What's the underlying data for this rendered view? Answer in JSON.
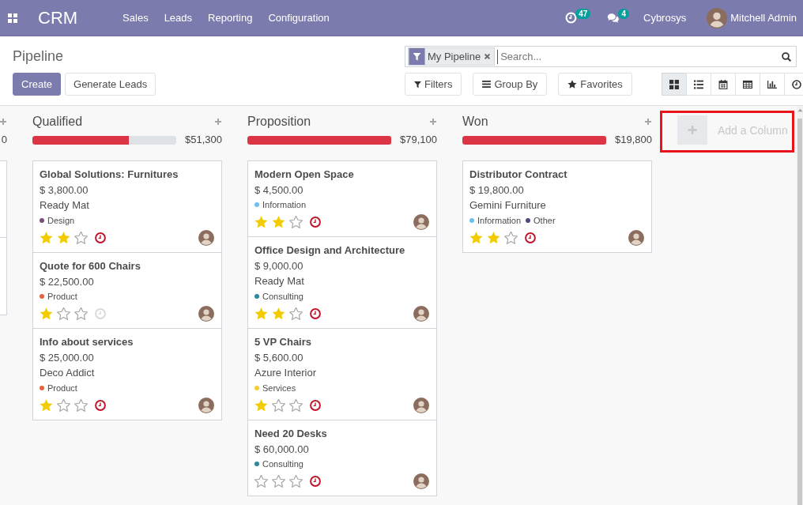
{
  "navbar": {
    "app_name": "CRM",
    "menu": [
      "Sales",
      "Leads",
      "Reporting",
      "Configuration"
    ],
    "activity_count": "47",
    "message_count": "4",
    "company": "Cybrosys",
    "user": "Mitchell Admin"
  },
  "control_panel": {
    "title": "Pipeline",
    "buttons": [
      {
        "label": "Create",
        "kind": "primary"
      },
      {
        "label": "Generate Leads",
        "kind": "secondary"
      }
    ],
    "search": {
      "facets": [
        {
          "label": "My Pipeline",
          "kind": "filter"
        }
      ],
      "placeholder": "Search..."
    },
    "search_options": [
      {
        "label": "Filters",
        "kind": "filter"
      },
      {
        "label": "Group By",
        "kind": "group"
      },
      {
        "label": "Favorites",
        "kind": "favorite"
      }
    ],
    "views": [
      {
        "kind": "kanban",
        "selected": true
      },
      {
        "kind": "list",
        "selected": false
      },
      {
        "kind": "calendar",
        "selected": false
      },
      {
        "kind": "pivot",
        "selected": false
      },
      {
        "kind": "graph",
        "selected": false
      },
      {
        "kind": "activity",
        "selected": false
      }
    ]
  },
  "kanban": {
    "partial_column": {
      "total": "0"
    },
    "columns": [
      {
        "title": "Qualified",
        "level": 0.67,
        "total": "$51,300",
        "cards": [
          {
            "title": "Global Solutions: Furnitures",
            "amount": "$ 3,800.00",
            "company": "Ready Mat",
            "tags": [
              {
                "label": "Design",
                "color": "#7c4e7a"
              }
            ],
            "stars": 2,
            "activity_overdue": true
          },
          {
            "title": "Quote for 600 Chairs",
            "amount": "$ 22,500.00",
            "tags": [
              {
                "label": "Product",
                "color": "#e4643f"
              }
            ],
            "stars": 1,
            "activity_overdue": false
          },
          {
            "title": "Info about services",
            "amount": "$ 25,000.00",
            "company": "Deco Addict",
            "tags": [
              {
                "label": "Product",
                "color": "#e4643f"
              }
            ],
            "stars": 1,
            "activity_overdue": true
          }
        ]
      },
      {
        "title": "Proposition",
        "level": 1,
        "total": "$79,100",
        "cards": [
          {
            "title": "Modern Open Space",
            "amount": "$ 4,500.00",
            "tags": [
              {
                "label": "Information",
                "color": "#6cbfee"
              }
            ],
            "stars": 2,
            "activity_overdue": true
          },
          {
            "title": "Office Design and Architecture",
            "amount": "$ 9,000.00",
            "company": "Ready Mat",
            "tags": [
              {
                "label": "Consulting",
                "color": "#2e8a9c"
              }
            ],
            "stars": 2,
            "activity_overdue": true
          },
          {
            "title": "5 VP Chairs",
            "amount": "$ 5,600.00",
            "company": "Azure Interior",
            "tags": [
              {
                "label": "Services",
                "color": "#f5cd34"
              }
            ],
            "stars": 1,
            "activity_overdue": true
          },
          {
            "title": "Need 20 Desks",
            "amount": "$ 60,000.00",
            "tags": [
              {
                "label": "Consulting",
                "color": "#2e8a9c"
              }
            ],
            "stars": 0,
            "activity_overdue": true
          }
        ]
      },
      {
        "title": "Won",
        "level": 1,
        "total": "$19,800",
        "cards": [
          {
            "title": "Distributor Contract",
            "amount": "$ 19,800.00",
            "company": "Gemini Furniture",
            "tags": [
              {
                "label": "Information",
                "color": "#6cbfee"
              },
              {
                "label": "Other",
                "color": "#4a4a7e"
              }
            ],
            "stars": 2,
            "activity_overdue": true
          }
        ]
      }
    ],
    "add_column": {
      "label": "Add a Column",
      "highlighted": true
    }
  }
}
